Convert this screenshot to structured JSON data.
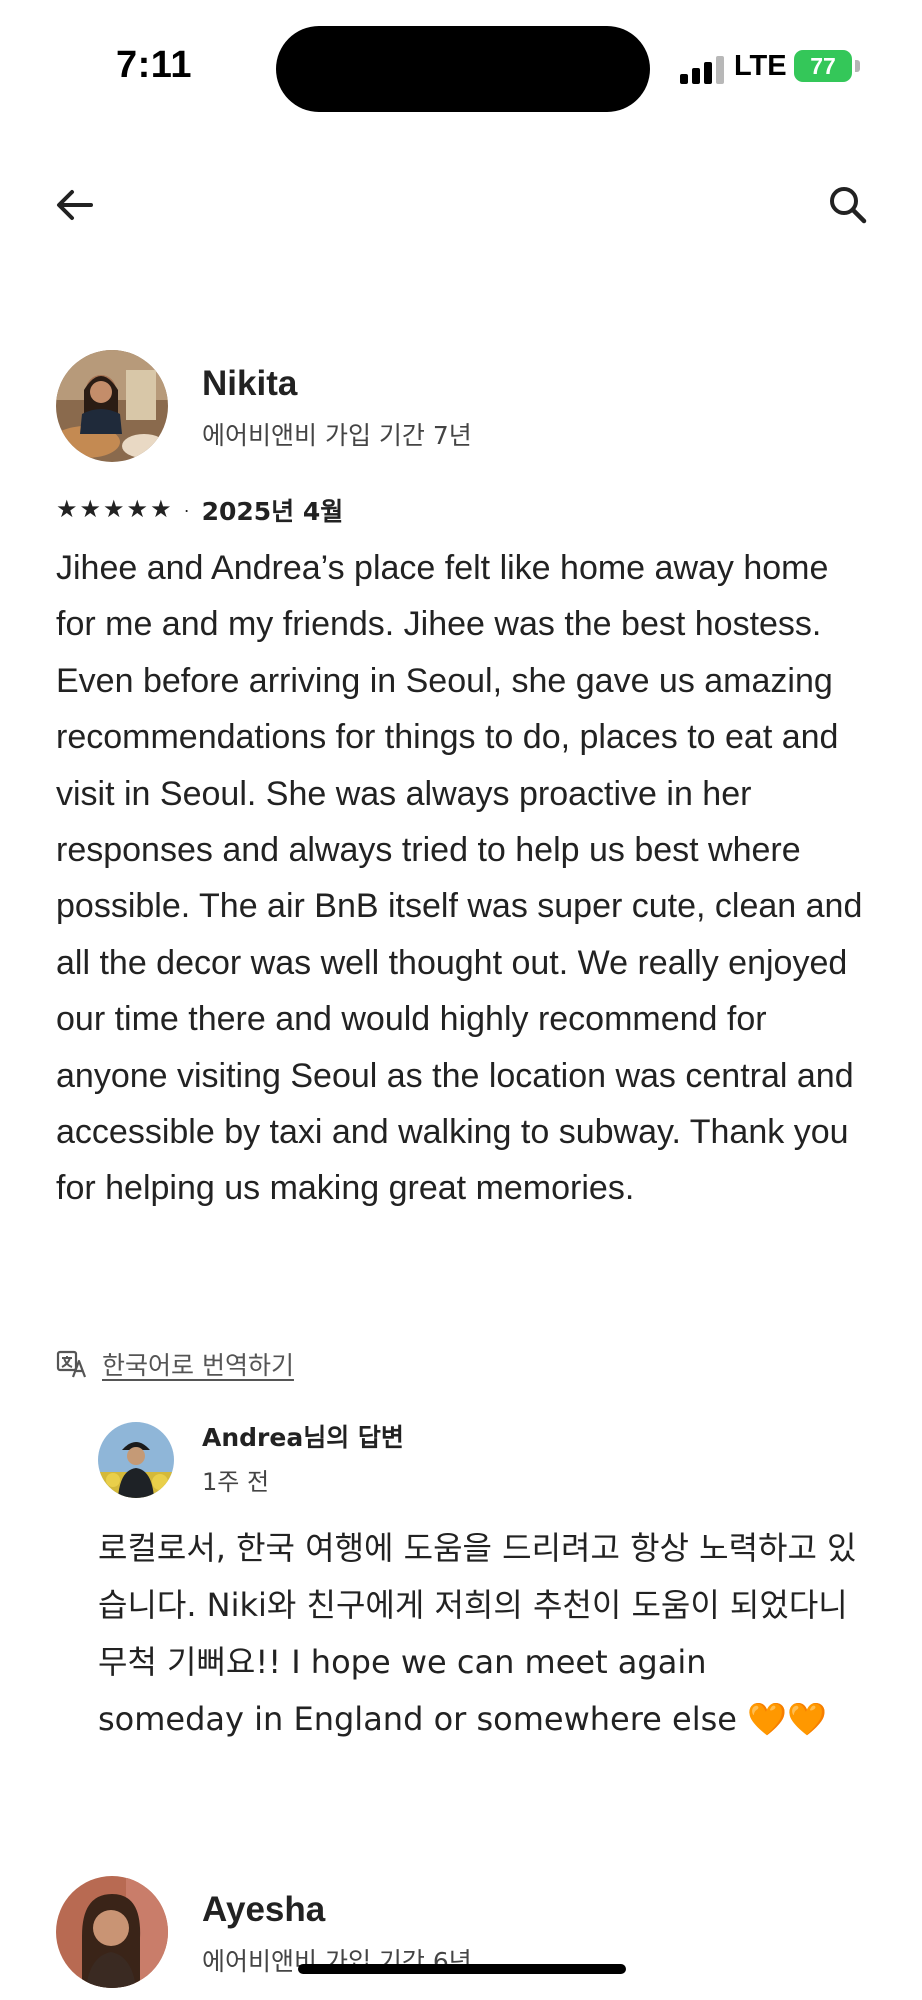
{
  "status_bar": {
    "time": "7:11",
    "network": "LTE",
    "battery": "77"
  },
  "nav": {
    "back_icon": "arrow-left-icon",
    "search_icon": "search-icon"
  },
  "review": {
    "reviewer_name": "Nikita",
    "reviewer_sub": "에어비앤비 가입 기간 7년",
    "rating": 5,
    "date": "2025년 4월",
    "text": "Jihee and Andrea’s place felt like home away home for me and my friends. Jihee was the best hostess. Even before arriving in Seoul, she gave us amazing recommendations for things to do, places to eat and visit in Seoul. She was always proactive in her responses and always tried to help us best where possible. The air BnB itself was super cute, clean and all the decor was well thought out. We really enjoyed our time there and would highly recommend for anyone visiting Seoul as the location was central and accessible by taxi and walking to subway. Thank you for helping us making great memories.",
    "translate_label": "한국어로 번역하기",
    "reply": {
      "name": "Andrea님의 답변",
      "time": "1주 전",
      "text": "로컬로서, 한국 여행에 도움을 드리려고 항상 노력하고 있습니다. Niki와 친구에게 저희의 추천이 도움이 되었다니 무척 기뻐요!! I hope we can meet again someday in England or somewhere else 🧡🧡"
    }
  },
  "next_review": {
    "reviewer_name": "Ayesha",
    "reviewer_sub": "에어비앤비 가입 기간 6년"
  },
  "colors": {
    "text": "#222222",
    "subtext": "#444444",
    "battery": "#34c759"
  }
}
